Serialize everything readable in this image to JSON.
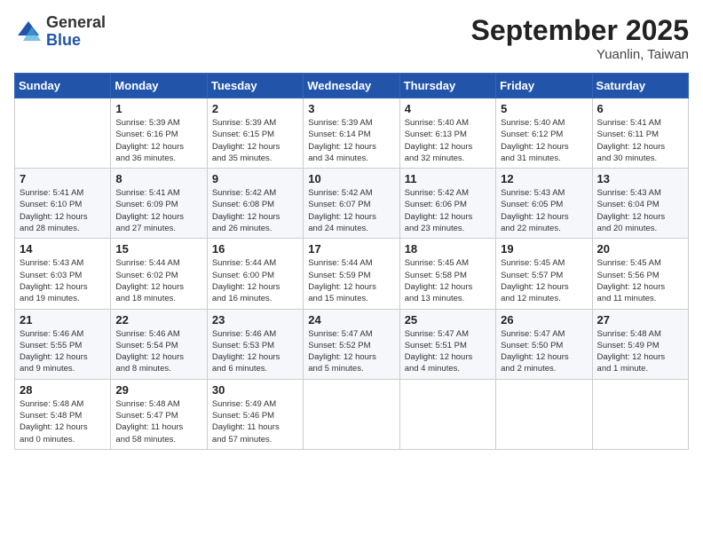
{
  "header": {
    "logo_general": "General",
    "logo_blue": "Blue",
    "month": "September 2025",
    "location": "Yuanlin, Taiwan"
  },
  "days_of_week": [
    "Sunday",
    "Monday",
    "Tuesday",
    "Wednesday",
    "Thursday",
    "Friday",
    "Saturday"
  ],
  "weeks": [
    [
      {
        "day": "",
        "info": ""
      },
      {
        "day": "1",
        "info": "Sunrise: 5:39 AM\nSunset: 6:16 PM\nDaylight: 12 hours\nand 36 minutes."
      },
      {
        "day": "2",
        "info": "Sunrise: 5:39 AM\nSunset: 6:15 PM\nDaylight: 12 hours\nand 35 minutes."
      },
      {
        "day": "3",
        "info": "Sunrise: 5:39 AM\nSunset: 6:14 PM\nDaylight: 12 hours\nand 34 minutes."
      },
      {
        "day": "4",
        "info": "Sunrise: 5:40 AM\nSunset: 6:13 PM\nDaylight: 12 hours\nand 32 minutes."
      },
      {
        "day": "5",
        "info": "Sunrise: 5:40 AM\nSunset: 6:12 PM\nDaylight: 12 hours\nand 31 minutes."
      },
      {
        "day": "6",
        "info": "Sunrise: 5:41 AM\nSunset: 6:11 PM\nDaylight: 12 hours\nand 30 minutes."
      }
    ],
    [
      {
        "day": "7",
        "info": "Sunrise: 5:41 AM\nSunset: 6:10 PM\nDaylight: 12 hours\nand 28 minutes."
      },
      {
        "day": "8",
        "info": "Sunrise: 5:41 AM\nSunset: 6:09 PM\nDaylight: 12 hours\nand 27 minutes."
      },
      {
        "day": "9",
        "info": "Sunrise: 5:42 AM\nSunset: 6:08 PM\nDaylight: 12 hours\nand 26 minutes."
      },
      {
        "day": "10",
        "info": "Sunrise: 5:42 AM\nSunset: 6:07 PM\nDaylight: 12 hours\nand 24 minutes."
      },
      {
        "day": "11",
        "info": "Sunrise: 5:42 AM\nSunset: 6:06 PM\nDaylight: 12 hours\nand 23 minutes."
      },
      {
        "day": "12",
        "info": "Sunrise: 5:43 AM\nSunset: 6:05 PM\nDaylight: 12 hours\nand 22 minutes."
      },
      {
        "day": "13",
        "info": "Sunrise: 5:43 AM\nSunset: 6:04 PM\nDaylight: 12 hours\nand 20 minutes."
      }
    ],
    [
      {
        "day": "14",
        "info": "Sunrise: 5:43 AM\nSunset: 6:03 PM\nDaylight: 12 hours\nand 19 minutes."
      },
      {
        "day": "15",
        "info": "Sunrise: 5:44 AM\nSunset: 6:02 PM\nDaylight: 12 hours\nand 18 minutes."
      },
      {
        "day": "16",
        "info": "Sunrise: 5:44 AM\nSunset: 6:00 PM\nDaylight: 12 hours\nand 16 minutes."
      },
      {
        "day": "17",
        "info": "Sunrise: 5:44 AM\nSunset: 5:59 PM\nDaylight: 12 hours\nand 15 minutes."
      },
      {
        "day": "18",
        "info": "Sunrise: 5:45 AM\nSunset: 5:58 PM\nDaylight: 12 hours\nand 13 minutes."
      },
      {
        "day": "19",
        "info": "Sunrise: 5:45 AM\nSunset: 5:57 PM\nDaylight: 12 hours\nand 12 minutes."
      },
      {
        "day": "20",
        "info": "Sunrise: 5:45 AM\nSunset: 5:56 PM\nDaylight: 12 hours\nand 11 minutes."
      }
    ],
    [
      {
        "day": "21",
        "info": "Sunrise: 5:46 AM\nSunset: 5:55 PM\nDaylight: 12 hours\nand 9 minutes."
      },
      {
        "day": "22",
        "info": "Sunrise: 5:46 AM\nSunset: 5:54 PM\nDaylight: 12 hours\nand 8 minutes."
      },
      {
        "day": "23",
        "info": "Sunrise: 5:46 AM\nSunset: 5:53 PM\nDaylight: 12 hours\nand 6 minutes."
      },
      {
        "day": "24",
        "info": "Sunrise: 5:47 AM\nSunset: 5:52 PM\nDaylight: 12 hours\nand 5 minutes."
      },
      {
        "day": "25",
        "info": "Sunrise: 5:47 AM\nSunset: 5:51 PM\nDaylight: 12 hours\nand 4 minutes."
      },
      {
        "day": "26",
        "info": "Sunrise: 5:47 AM\nSunset: 5:50 PM\nDaylight: 12 hours\nand 2 minutes."
      },
      {
        "day": "27",
        "info": "Sunrise: 5:48 AM\nSunset: 5:49 PM\nDaylight: 12 hours\nand 1 minute."
      }
    ],
    [
      {
        "day": "28",
        "info": "Sunrise: 5:48 AM\nSunset: 5:48 PM\nDaylight: 12 hours\nand 0 minutes."
      },
      {
        "day": "29",
        "info": "Sunrise: 5:48 AM\nSunset: 5:47 PM\nDaylight: 11 hours\nand 58 minutes."
      },
      {
        "day": "30",
        "info": "Sunrise: 5:49 AM\nSunset: 5:46 PM\nDaylight: 11 hours\nand 57 minutes."
      },
      {
        "day": "",
        "info": ""
      },
      {
        "day": "",
        "info": ""
      },
      {
        "day": "",
        "info": ""
      },
      {
        "day": "",
        "info": ""
      }
    ]
  ]
}
